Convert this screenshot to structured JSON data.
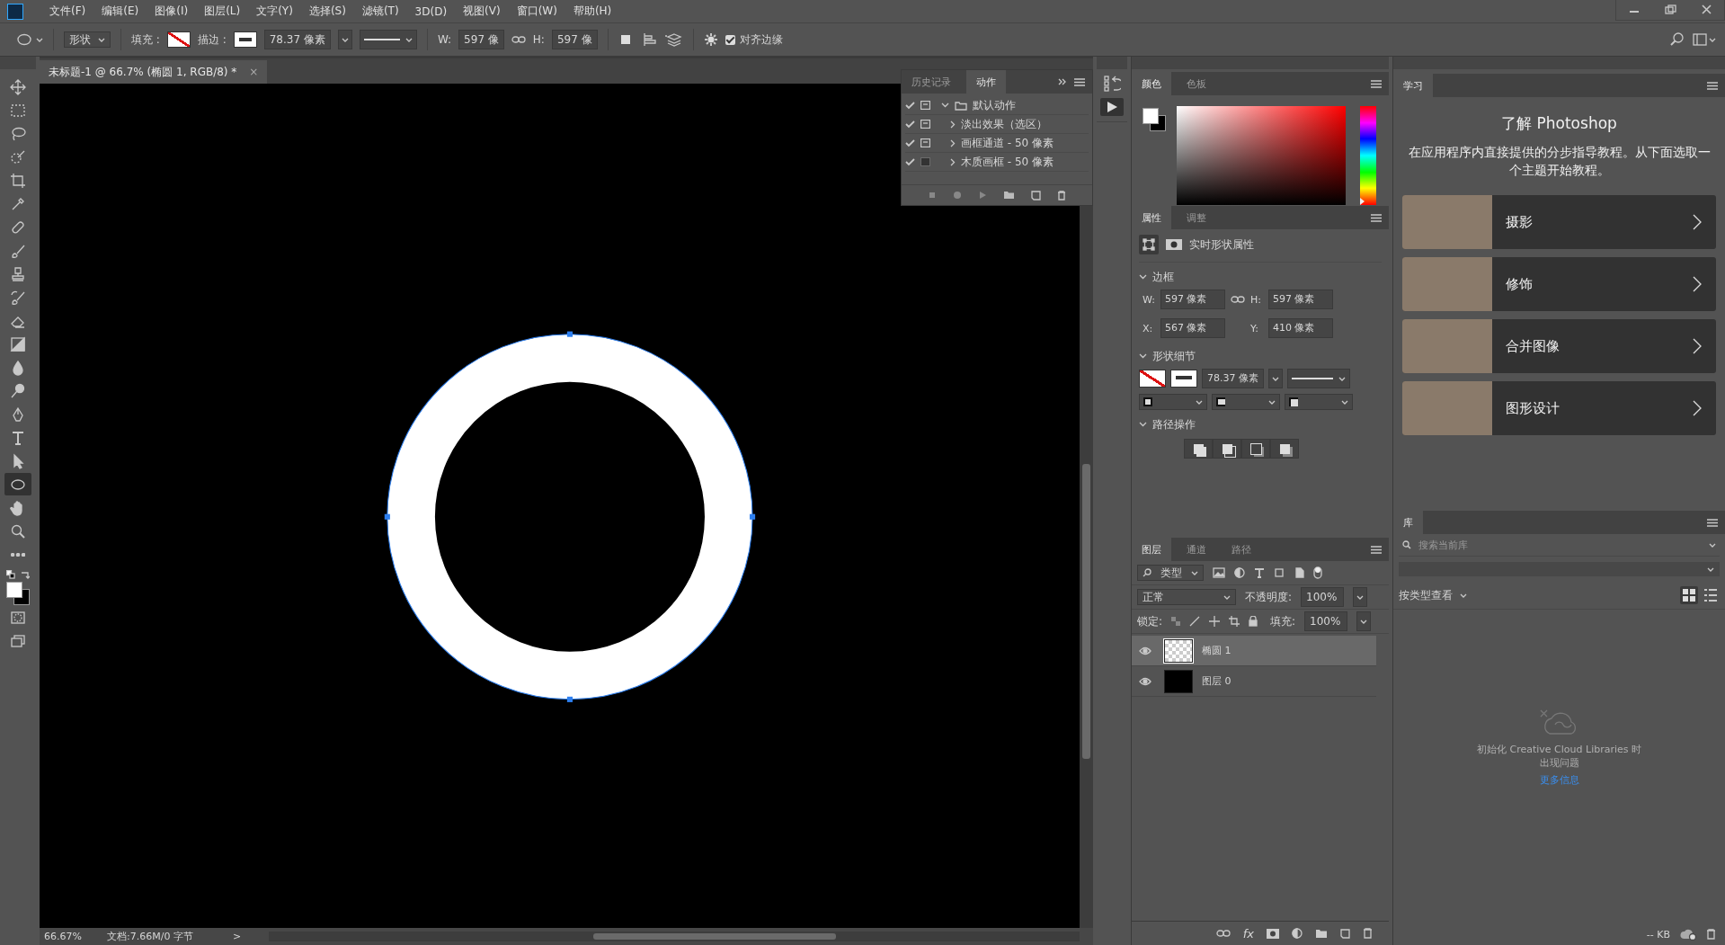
{
  "menu_bar": {
    "items": [
      "文件(F)",
      "编辑(E)",
      "图像(I)",
      "图层(L)",
      "文字(Y)",
      "选择(S)",
      "滤镜(T)",
      "3D(D)",
      "视图(V)",
      "窗口(W)",
      "帮助(H)"
    ]
  },
  "options_bar": {
    "shape_mode": "形状",
    "fill_label": "填充 :",
    "stroke_label": "描边 :",
    "stroke_width": "78.37 像素",
    "w_label": "W:",
    "w_value": "597 像",
    "h_label": "H:",
    "h_value": "597 像",
    "align_edges": {
      "label": "对齐边缘",
      "checked": true
    }
  },
  "document_tab": {
    "title": "未标题-1 @ 66.7% (椭圆 1, RGB/8) *",
    "close": "×"
  },
  "tools": [
    {
      "kind": "move",
      "selected": false
    },
    {
      "kind": "marquee",
      "selected": false
    },
    {
      "kind": "lasso",
      "selected": false
    },
    {
      "kind": "quick",
      "selected": false
    },
    {
      "kind": "crop",
      "selected": false
    },
    {
      "kind": "eyedropper",
      "selected": false
    },
    {
      "kind": "heal",
      "selected": false
    },
    {
      "kind": "brush",
      "selected": false
    },
    {
      "kind": "stamp",
      "selected": false
    },
    {
      "kind": "history",
      "selected": false
    },
    {
      "kind": "eraser",
      "selected": false
    },
    {
      "kind": "gradient",
      "selected": false
    },
    {
      "kind": "blur",
      "selected": false
    },
    {
      "kind": "dodge",
      "selected": false
    },
    {
      "kind": "pen",
      "selected": false
    },
    {
      "kind": "type",
      "selected": false
    },
    {
      "kind": "pathselect",
      "selected": false
    },
    {
      "kind": "ellipse",
      "selected": true
    },
    {
      "kind": "hand",
      "selected": false
    },
    {
      "kind": "zoom",
      "selected": false
    },
    {
      "kind": "more",
      "selected": false
    }
  ],
  "actions_panel": {
    "tabs": [
      {
        "label": "历史记录",
        "selected": false
      },
      {
        "label": "动作",
        "selected": true
      }
    ],
    "items": [
      {
        "label": "默认动作",
        "kind": "set",
        "checked": true,
        "dialog": true,
        "expanded": true
      },
      {
        "label": "淡出效果（选区）",
        "kind": "action",
        "checked": true,
        "dialog": true,
        "expanded": false
      },
      {
        "label": "画框通道 - 50 像素",
        "kind": "action",
        "checked": true,
        "dialog": true,
        "expanded": false
      },
      {
        "label": "木质画框 - 50 像素",
        "kind": "action",
        "checked": true,
        "dialog": false,
        "expanded": false
      }
    ]
  },
  "color_panel": {
    "tabs": [
      {
        "label": "颜色",
        "selected": true
      },
      {
        "label": "色板",
        "selected": false
      }
    ],
    "hue": {
      "level": 0
    }
  },
  "properties_panel": {
    "tabs": [
      {
        "label": "属性",
        "selected": true
      },
      {
        "label": "调整",
        "selected": false
      }
    ],
    "heading": "实时形状属性",
    "transform_section": {
      "title": "边框",
      "expanded": true,
      "w_label": "W:",
      "w": "597 像素",
      "h_label": "H:",
      "h": "597 像素",
      "x_label": "X:",
      "x": "567 像素",
      "y_label": "Y:",
      "y": "410 像素"
    },
    "shape_section": {
      "title": "形状细节",
      "expanded": true,
      "stroke_width": "78.37 像素"
    },
    "path_section": {
      "title": "路径操作",
      "expanded": true
    }
  },
  "layers_panel": {
    "tabs": [
      {
        "label": "图层",
        "selected": true
      },
      {
        "label": "通道",
        "selected": false
      },
      {
        "label": "路径",
        "selected": false
      }
    ],
    "filter": "类型",
    "blend_mode": "正常",
    "opacity_label": "不透明度:",
    "opacity": "100%",
    "lock_label": "锁定:",
    "fill_label": "填充:",
    "fill": "100%",
    "layers": [
      {
        "name": "椭圆 1",
        "kind": "shape",
        "visible": true,
        "selected": true
      },
      {
        "name": "图层 0",
        "kind": "solid",
        "visible": true,
        "selected": false
      }
    ],
    "style_button": "fx"
  },
  "learn_panel": {
    "tab": "学习",
    "title": "了解 Photoshop",
    "description": "在应用程序内直接提供的分步指导教程。从下面选取一个主题开始教程。",
    "topics": [
      "摄影",
      "修饰",
      "合并图像",
      "图形设计"
    ]
  },
  "library_panel": {
    "tab": "库",
    "search_placeholder": "搜索当前库",
    "view_label": "按类型查看",
    "view_options": [
      {
        "kind": "grid",
        "selected": true
      },
      {
        "kind": "list",
        "selected": false
      }
    ],
    "message": "初始化 Creative Cloud Libraries 时出现问题",
    "link": "更多信息",
    "storage": "-- KB"
  },
  "status_bar": {
    "zoom": "66.67%",
    "doc_info": "文档:7.66M/0 字节",
    "arrow": ">"
  }
}
